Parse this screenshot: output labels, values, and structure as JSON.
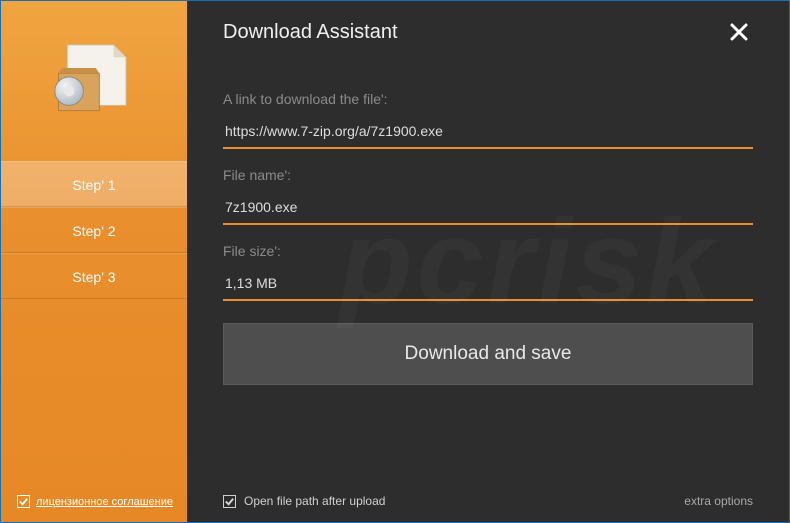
{
  "header": {
    "title": "Download Assistant"
  },
  "sidebar": {
    "steps": [
      {
        "label": "Step' 1",
        "active": true
      },
      {
        "label": "Step' 2",
        "active": false
      },
      {
        "label": "Step' 3",
        "active": false
      }
    ],
    "license_checked": true,
    "license_label": "лицензионное соглашение"
  },
  "form": {
    "link_label": "A link to download the file':",
    "link_value": "https://www.7-zip.org/a/7z1900.exe",
    "filename_label": "File name':",
    "filename_value": "7z1900.exe",
    "filesize_label": "File size':",
    "filesize_value": "1,13 MB",
    "download_button": "Download and save"
  },
  "footer": {
    "open_path_checked": true,
    "open_path_label": "Open file path after upload",
    "extra_options": "extra options"
  },
  "colors": {
    "accent": "#e98f2e",
    "bg": "#2d2d2d",
    "border": "#1a6fb0"
  }
}
